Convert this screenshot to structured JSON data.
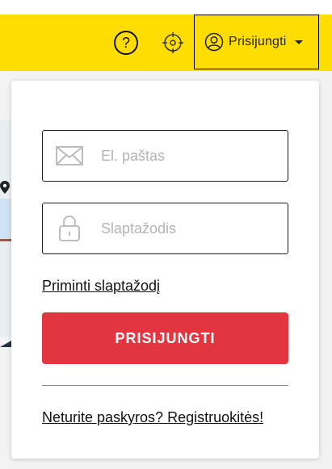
{
  "header": {
    "background_color": "#ffdd00",
    "help_icon": "question-circle-icon",
    "locate_icon": "crosshair-icon",
    "login_toggle_label": "Prisijungti",
    "login_toggle_icon": "user-circle-icon"
  },
  "login_panel": {
    "email_placeholder": "El. paštas",
    "email_icon": "envelope-icon",
    "password_placeholder": "Slaptažodis",
    "password_icon": "lock-icon",
    "remind_password_link": "Priminti slaptažodį",
    "submit_label": "PRISIJUNGTI",
    "submit_color": "#e2353f",
    "register_link": "Neturite paskyros? Registruokitės!"
  }
}
